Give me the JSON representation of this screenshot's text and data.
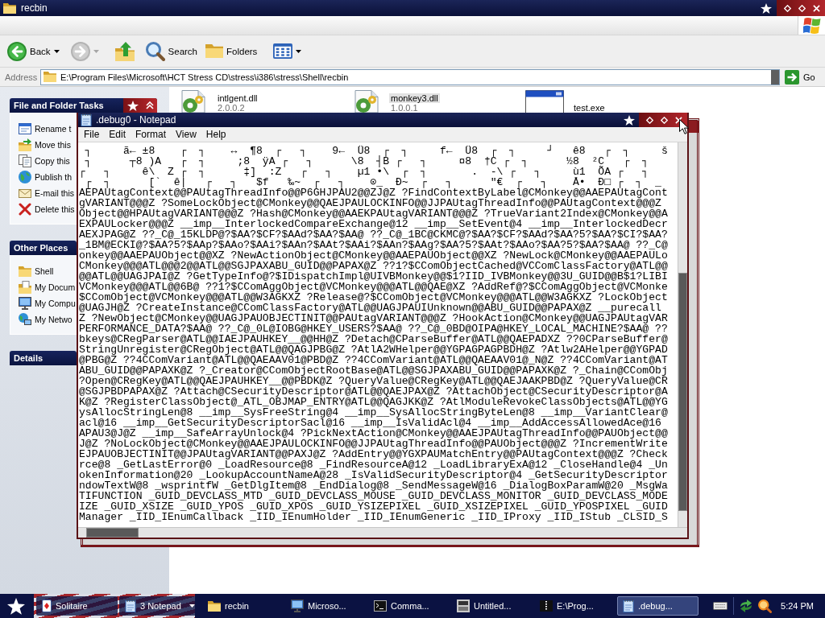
{
  "explorer": {
    "title": "recbin",
    "toolbar": [
      {
        "kind": "back",
        "label": "Back",
        "disabled": false
      },
      {
        "kind": "forward",
        "disabled": true
      },
      {
        "kind": "up",
        "disabled": false
      },
      {
        "kind": "search",
        "label": "Search",
        "disabled": false
      },
      {
        "kind": "folders",
        "label": "Folders",
        "disabled": false
      },
      {
        "kind": "views",
        "disabled": false
      }
    ],
    "address": {
      "label": "Address",
      "value": "E:\\Program Files\\Microsoft\\HCT Stress CD\\stress\\i386\\stress\\Shell\\recbin",
      "go": "Go"
    },
    "task_panes": [
      {
        "title": "File and Folder Tasks",
        "expanded": true,
        "items": [
          {
            "kind": "rename",
            "label": "Rename t"
          },
          {
            "kind": "move",
            "label": "Move this"
          },
          {
            "kind": "copy",
            "label": "Copy this"
          },
          {
            "kind": "publish",
            "label": "Publish th"
          },
          {
            "kind": "email",
            "label": "E-mail this"
          },
          {
            "kind": "delete",
            "label": "Delete this"
          }
        ]
      },
      {
        "title": "Other Places",
        "items": [
          {
            "kind": "folder",
            "label": "Shell"
          },
          {
            "kind": "documents",
            "label": "My Docum"
          },
          {
            "kind": "computer",
            "label": "My Compu"
          },
          {
            "kind": "network",
            "label": "My Netwo"
          }
        ]
      },
      {
        "title": "Details"
      }
    ],
    "files": [
      {
        "kind": "dll",
        "name": "intlgent.dll",
        "version": "2.0.0.2",
        "selected": false
      },
      {
        "kind": "dll",
        "name": "monkey3.dll",
        "version": "1.0.0.1",
        "selected": true
      },
      {
        "kind": "exe",
        "name": "test.exe",
        "selected": false
      }
    ]
  },
  "notepad": {
    "title": ".debug0 - Notepad",
    "menu": [
      "File",
      "Edit",
      "Format",
      "View",
      "Help"
    ],
    "lines": [
      " ┐     ã← ±8    ┌  ┐    ↔  ¶8  ┌   ┐    9←  Ü8  ┌  ┐     f←  Ü8  ┌  ┐     ┘   ê8   ┌  ┐     š",
      " ┐      ┬8 )A   ┌  ┐     ;8  ÿA ┌   ┐      \\8  ┤B ┌   ┐     ¤8  †C ┌  ┐      ½8  ²C   ┌  ┐",
      "┌   ┐     ê\\  Z ┌  ┐      ‡]  :Z   ┌   ┐    µ1 •\\  ┌  ┐       .  -\\ ┌   ┐     ù1  ÕA ┌   ┐",
      " ┌  ┐      [`  ê|   ┌   ┐   $f   ‰~  ┌   ┐    ⊙_  Ð~  ┌   ┐      \"€  ┌   ┐    Å•  Ð□ ┌  ┐  _",
      "AEPAUtagContext@@PAUtagThreadInfo@@P6GHJPAU2@@ZJ@Z ?FindContextByLabel@CMonkey@@AAEPAUtagCont",
      "gVARIANT@@@Z ?SomeLockObject@CMonkey@@QAEJPAULOCKINFO@@JJPAUtagThreadInfo@@PAUtagContext@@@Z",
      "Object@@HPAUtagVARIANT@@@Z ?Hash@CMonkey@@AAEKPAUtagVARIANT@@@Z ?TrueVariant2Index@CMonkey@@A",
      "EXPAULocker@@@Z __imp__InterlockedCompareExchange@12 __imp__SetEvent@4 __imp__InterlockedDecr",
      "AEXJPAG@Z ??_C@_15KLDP@?$AA?$CF?$AAd?$AA?$AA@ ??_C@_1BC@CKMC@?$AA?$CF?$AAd?$AA?5?$AA?$CI?$AA?",
      "_1BM@ECKI@?$AA?5?$AAp?$AAo?$AAi?$AAn?$AAt?$AAi?$AAn?$AAg?$AA?5?$AAt?$AAo?$AA?5?$AA?$AA@ ??_C@",
      "onkey@@AAEPAUObject@@XZ ?NewActionObject@CMonkey@@AAEPAUObject@@XZ ?NewLock@CMonkey@@AAEPAULo",
      "CMonkey@@@ATL@@@2@@ATL@@SGJPAXABU_GUID@@PAPAX@Z ??1?$CComObjectCached@VCComClassFactory@ATL@@",
      "@@ATL@@UAGJPAI@Z ?GetTypeInfo@?$IDispatchImpl@UIVBMonkey@@$1?IID_IVBMonkey@@3U_GUID@@B$1?LIBI",
      "VCMonkey@@@ATL@@6B@ ??1?$CComAggObject@VCMonkey@@@ATL@@QAE@XZ ?AddRef@?$CComAggObject@VCMonke",
      "$CComObject@VCMonkey@@@ATL@@W3AGKXZ ?Release@?$CComObject@VCMonkey@@@ATL@@W3AGKXZ ?LockObject",
      "@UAGJH@Z ?CreateInstance@CComClassFactory@ATL@@UAGJPAUIUnknown@@ABU_GUID@@PAPAX@Z __purecall",
      "Z ?NewObject@CMonkey@@UAGJPAUOBJECTINIT@@PAUtagVARIANT@@@Z ?HookAction@CMonkey@@UAGJPAUtagVAR",
      "PERFORMANCE_DATA?$AA@ ??_C@_0L@IOBG@HKEY_USERS?$AA@ ??_C@_0BD@OIPA@HKEY_LOCAL_MACHINE?$AA@ ??",
      "bkeys@CRegParser@ATL@@IAEJPAUHKEY__@@HH@Z ?Detach@CParseBuffer@ATL@@QAEPADXZ ??0CParseBuffer@",
      "StringUnregister@CRegObject@ATL@@QAGJPBG@Z ?AtlA2WHelper@@YGPAGPAGPBDH@Z ?Atlw2AHelper@@YGPAD",
      "@PBG@Z ??4CComVariant@ATL@@QAEAAV01@PBD@Z ??4CComVariant@ATL@@QAEAAV01@_N@Z ??4CComVariant@AT",
      "ABU_GUID@@PAPAXK@Z ?_Creator@CComObjectRootBase@ATL@@SGJPAXABU_GUID@@PAPAXK@Z ?_Chain@CComObj",
      "?Open@CRegKey@ATL@@QAEJPAUHKEY__@@PBDK@Z ?QueryValue@CRegKey@ATL@@QAEJAAKPBD@Z ?QueryValue@CR",
      "@SGJPBDPAPAX@Z ?Attach@CSecurityDescriptor@ATL@@QAEJPAX@Z ?AttachObject@CSecurityDescriptor@A",
      "K@Z ?RegisterClassObject@_ATL_OBJMAP_ENTRY@ATL@@QAGJKK@Z ?AtlModuleRevokeClassObjects@ATL@@YG",
      "ysAllocStringLen@8 __imp__SysFreeString@4 __imp__SysAllocStringByteLen@8 __imp__VariantClear@",
      "acl@16 __imp__GetSecurityDescriptorSacl@16 __imp__IsValidAcl@4 __imp__AddAccessAllowedAce@16",
      "APAU3@J@Z __imp__SafeArrayUnlock@4 ?PickNextAction@CMonkey@@AAEJPAUtagThreadInfo@@PAUObject@@",
      "J@Z ?NoLockObject@CMonkey@@AAEJPAULOCKINFO@@JJPAUtagThreadInfo@@PAUObject@@@Z ?IncrementWrite",
      "EJPAUOBJECTINIT@@JPAUtagVARIANT@@PAXJ@Z ?AddEntry@@YGXPAUMatchEntry@@PAUtagContext@@@Z ?Check",
      "rce@8 _GetLastError@0 _LoadResource@8 _FindResourceA@12 _LoadLibraryExA@12 _CloseHandle@4 _Un",
      "okenInformation@20 _LookupAccountNameA@28 _IsValidSecurityDescriptor@4 _GetSecurityDescriptor",
      "ndowTextW@8 _wsprintfW _GetDlgItem@8 _EndDialog@8 _SendMessageW@16 _DialogBoxParamW@20 _MsgWa",
      "TIFUNCTION _GUID_DEVCLASS_MTD _GUID_DEVCLASS_MOUSE _GUID_DEVCLASS_MONITOR _GUID_DEVCLASS_MODE",
      "IZE _GUID_XSIZE _GUID_YPOS _GUID_XPOS _GUID_YSIZEPIXEL _GUID_XSIZEPIXEL _GUID_YPOSPIXEL _GUID",
      "Manager _IID_IEnumCallback _IID_IEnumHolder _IID_IEnumGeneric _IID_IProxy _IID_IStub _CLSID_S"
    ]
  },
  "taskbar": {
    "items": [
      {
        "kind": "solitaire",
        "label": "Solitaire",
        "grouped": false,
        "selected": false
      },
      {
        "kind": "notepad",
        "label": "3 Notepad",
        "grouped": true,
        "selected": false
      },
      {
        "kind": "folder",
        "label": "recbin",
        "grouped": false,
        "selected": false
      },
      {
        "kind": "monitor",
        "label": "Microso...",
        "grouped": false,
        "selected": false
      },
      {
        "kind": "console",
        "label": "Comma...",
        "grouped": false,
        "selected": false
      },
      {
        "kind": "afx",
        "label": "Untitled...",
        "grouped": false,
        "selected": false
      },
      {
        "kind": "archive",
        "label": "E:\\Prog...",
        "grouped": false,
        "selected": false
      },
      {
        "kind": "notepad",
        "label": ".debug...",
        "grouped": false,
        "selected": true
      }
    ],
    "clock": "5:24 PM"
  }
}
